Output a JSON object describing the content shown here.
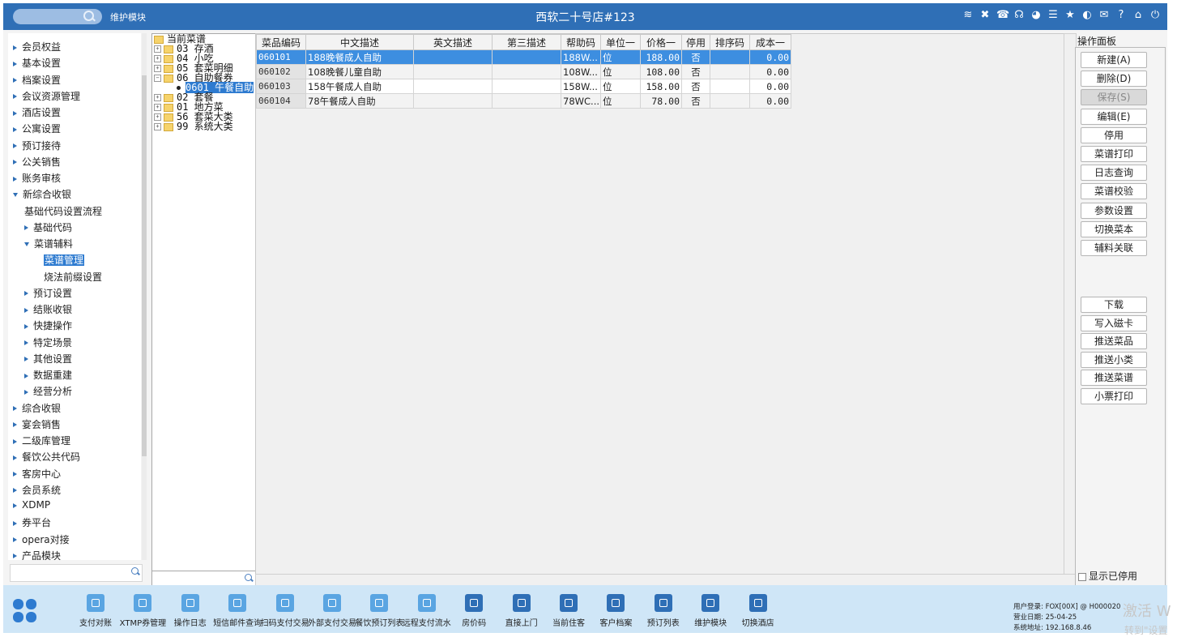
{
  "header": {
    "module": "维护模块",
    "title": "西软二十号店#123",
    "icons": [
      "wifi-icon",
      "tools-icon",
      "phone-icon",
      "headset-icon",
      "palette-icon",
      "menu-icon",
      "star-icon",
      "contrast-icon",
      "mail-icon",
      "help-icon",
      "home-icon",
      "power-icon"
    ]
  },
  "sidebar": {
    "items": [
      {
        "label": "会员权益",
        "level": 0,
        "arrow": "right"
      },
      {
        "label": "基本设置",
        "level": 0,
        "arrow": "right"
      },
      {
        "label": "档案设置",
        "level": 0,
        "arrow": "right"
      },
      {
        "label": "会议资源管理",
        "level": 0,
        "arrow": "right"
      },
      {
        "label": "酒店设置",
        "level": 0,
        "arrow": "right"
      },
      {
        "label": "公寓设置",
        "level": 0,
        "arrow": "right"
      },
      {
        "label": "预订接待",
        "level": 0,
        "arrow": "right"
      },
      {
        "label": "公关销售",
        "level": 0,
        "arrow": "right"
      },
      {
        "label": "账务审核",
        "level": 0,
        "arrow": "right"
      },
      {
        "label": "新综合收银",
        "level": 0,
        "arrow": "down"
      },
      {
        "label": "基础代码设置流程",
        "level": 1,
        "arrow": "none"
      },
      {
        "label": "基础代码",
        "level": 1,
        "arrow": "right"
      },
      {
        "label": "菜谱辅料",
        "level": 1,
        "arrow": "down"
      },
      {
        "label": "菜谱管理",
        "level": 2,
        "arrow": "none",
        "selected": true
      },
      {
        "label": "烧法前缀设置",
        "level": 2,
        "arrow": "none"
      },
      {
        "label": "预订设置",
        "level": 1,
        "arrow": "right"
      },
      {
        "label": "结账收银",
        "level": 1,
        "arrow": "right"
      },
      {
        "label": "快捷操作",
        "level": 1,
        "arrow": "right"
      },
      {
        "label": "特定场景",
        "level": 1,
        "arrow": "right"
      },
      {
        "label": "其他设置",
        "level": 1,
        "arrow": "right"
      },
      {
        "label": "数据重建",
        "level": 1,
        "arrow": "right"
      },
      {
        "label": "经营分析",
        "level": 1,
        "arrow": "right"
      },
      {
        "label": "综合收银",
        "level": 0,
        "arrow": "right"
      },
      {
        "label": "宴会销售",
        "level": 0,
        "arrow": "right"
      },
      {
        "label": "二级库管理",
        "level": 0,
        "arrow": "right"
      },
      {
        "label": "餐饮公共代码",
        "level": 0,
        "arrow": "right"
      },
      {
        "label": "客房中心",
        "level": 0,
        "arrow": "right"
      },
      {
        "label": "会员系统",
        "level": 0,
        "arrow": "right"
      },
      {
        "label": "XDMP",
        "level": 0,
        "arrow": "right"
      },
      {
        "label": "券平台",
        "level": 0,
        "arrow": "right"
      },
      {
        "label": "opera对接",
        "level": 0,
        "arrow": "right"
      },
      {
        "label": "产品模块",
        "level": 0,
        "arrow": "right"
      }
    ]
  },
  "tree": {
    "nodes": [
      {
        "label": "当前菜谱",
        "type": "root"
      },
      {
        "label": "03 存酒",
        "type": "folder"
      },
      {
        "label": "04 小吃",
        "type": "folder"
      },
      {
        "label": "05 套菜明细",
        "type": "folder"
      },
      {
        "label": "06 自助餐券",
        "type": "open"
      },
      {
        "label": "0601 午餐自助",
        "type": "leaf",
        "selected": true
      },
      {
        "label": "02 套餐",
        "type": "folder"
      },
      {
        "label": "01 地方菜",
        "type": "folder"
      },
      {
        "label": "56 套菜大类",
        "type": "folder"
      },
      {
        "label": "99 系统大类",
        "type": "folder"
      }
    ]
  },
  "grid": {
    "columns": [
      "菜品编码",
      "中文描述",
      "英文描述",
      "第三描述",
      "帮助码",
      "单位一",
      "价格一",
      "停用",
      "排序码",
      "成本一"
    ],
    "rows": [
      {
        "code": "060101",
        "cn": "188晚餐成人自助",
        "en": "",
        "third": "",
        "help": "188W...",
        "unit": "位",
        "price": "188.00",
        "disabled": "否",
        "sort": "",
        "cost": "0.00",
        "selected": true
      },
      {
        "code": "060102",
        "cn": "108晚餐儿童自助",
        "en": "",
        "third": "",
        "help": "108W...",
        "unit": "位",
        "price": "108.00",
        "disabled": "否",
        "sort": "",
        "cost": "0.00"
      },
      {
        "code": "060103",
        "cn": "158午餐成人自助",
        "en": "",
        "third": "",
        "help": "158W...",
        "unit": "位",
        "price": "158.00",
        "disabled": "否",
        "sort": "",
        "cost": "0.00"
      },
      {
        "code": "060104",
        "cn": "78午餐成人自助",
        "en": "",
        "third": "",
        "help": "78WC...",
        "unit": "位",
        "price": "78.00",
        "disabled": "否",
        "sort": "",
        "cost": "0.00"
      }
    ]
  },
  "panel": {
    "title": "操作面板",
    "buttons": [
      {
        "label": "新建(A)",
        "name": "new-button"
      },
      {
        "label": "删除(D)",
        "name": "delete-button"
      },
      {
        "label": "保存(S)",
        "name": "save-button",
        "disabled": true
      },
      {
        "label": "编辑(E)",
        "name": "edit-button"
      },
      {
        "label": "停用",
        "name": "disable-button"
      },
      {
        "label": "菜谱打印",
        "name": "menu-print-button"
      },
      {
        "label": "日志查询",
        "name": "log-query-button"
      },
      {
        "label": "菜谱校验",
        "name": "menu-validate-button"
      },
      {
        "label": "参数设置",
        "name": "param-settings-button"
      },
      {
        "label": "切换菜本",
        "name": "switch-menu-book-button"
      },
      {
        "label": "辅料关联",
        "name": "ingredient-link-button"
      }
    ],
    "buttons2": [
      {
        "label": "下载",
        "name": "download-button"
      },
      {
        "label": "写入磁卡",
        "name": "write-card-button"
      },
      {
        "label": "推送菜品",
        "name": "push-dishes-button"
      },
      {
        "label": "推送小类",
        "name": "push-subcategory-button"
      },
      {
        "label": "推送菜谱",
        "name": "push-menu-button"
      },
      {
        "label": "小票打印",
        "name": "receipt-print-button"
      }
    ],
    "show_disabled": "显示已停用"
  },
  "footer": {
    "tools": [
      {
        "label": "支付对账",
        "name": "payment-reconcile"
      },
      {
        "label": "XTMP券管理",
        "name": "xtmp-coupon"
      },
      {
        "label": "操作日志",
        "name": "operation-log"
      },
      {
        "label": "短信邮件查询",
        "name": "sms-mail-query"
      },
      {
        "label": "扫码支付交易",
        "name": "scan-pay"
      },
      {
        "label": "外部支付交易",
        "name": "external-pay"
      },
      {
        "label": "餐饮预订列表",
        "name": "dining-booking-list"
      },
      {
        "label": "远程支付流水",
        "name": "remote-pay-flow"
      },
      {
        "label": "房价码",
        "name": "rate-code"
      },
      {
        "label": "直接上门",
        "name": "walk-in"
      },
      {
        "label": "当前住客",
        "name": "current-guests"
      },
      {
        "label": "客户档案",
        "name": "customer-profile"
      },
      {
        "label": "预订列表",
        "name": "booking-list"
      },
      {
        "label": "维护模块",
        "name": "maintenance-module"
      },
      {
        "label": "切换酒店",
        "name": "switch-hotel"
      }
    ],
    "status": {
      "user": "用户登录:   FOX[00X] @ H000020",
      "date": "营业日期:   25-04-25",
      "addr": "系统地址:   192.168.8.46"
    }
  },
  "watermark": {
    "line1": "激活 W",
    "line2": "转到\"设置"
  }
}
